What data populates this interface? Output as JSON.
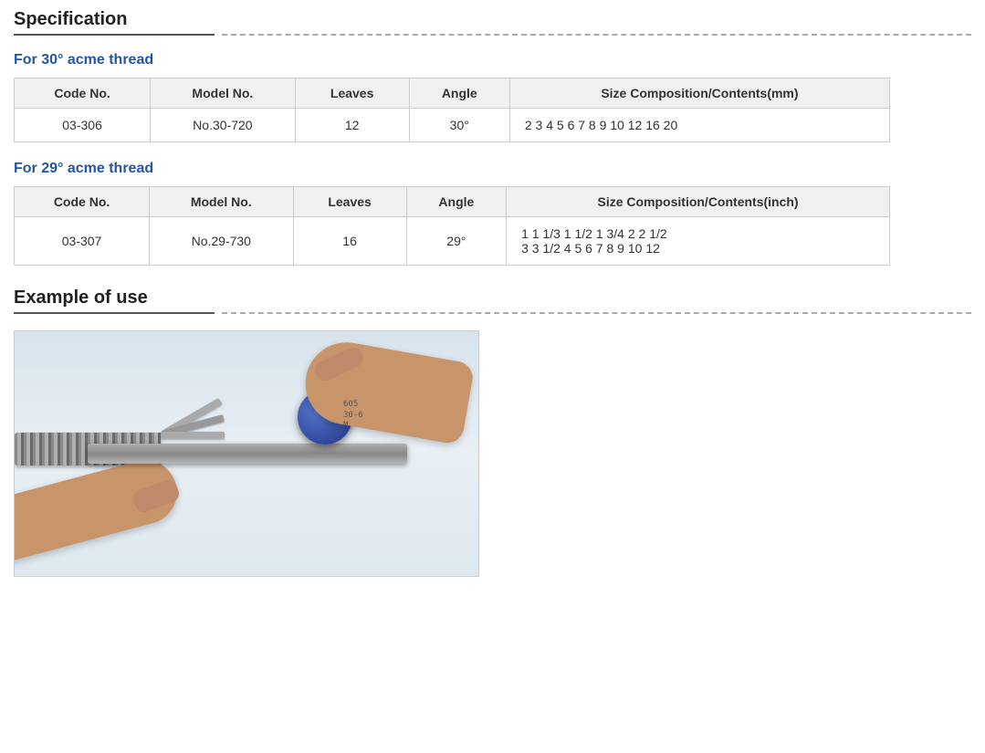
{
  "page": {
    "specification_title": "Specification",
    "table30_subtitle": "For 30° acme thread",
    "table29_subtitle": "For 29° acme thread",
    "example_title": "Example of use",
    "columns": [
      "Code No.",
      "Model No.",
      "Leaves",
      "Angle",
      "Size Composition/Contents(mm)"
    ],
    "columns29": [
      "Code No.",
      "Model No.",
      "Leaves",
      "Angle",
      "Size Composition/Contents(inch)"
    ],
    "row30": {
      "code": "03-306",
      "model": "No.30-720",
      "leaves": "12",
      "angle": "30°",
      "size": "2  3  4  5  6  7  8  9  10  12  16  20"
    },
    "row29": {
      "code": "03-307",
      "model": "No.29-730",
      "leaves": "16",
      "angle": "29°",
      "size_line1": "1   1 1/3   1 1/2   1 3/4   2   2 1/2",
      "size_line2": "3   3 1/2   4   5   6   7   8   9   10   12"
    }
  }
}
